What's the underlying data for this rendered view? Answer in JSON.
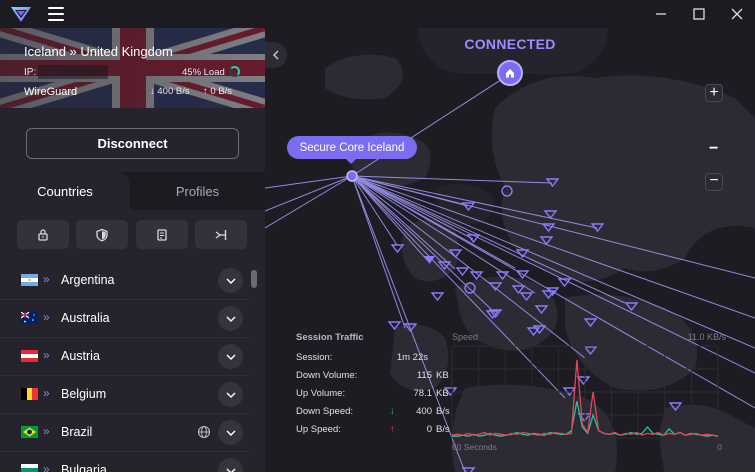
{
  "app": {
    "title": "Proton VPN"
  },
  "connection": {
    "route": "Iceland » United Kingdom",
    "ip_label": "IP:",
    "load": "45% Load",
    "protocol": "WireGuard",
    "down_speed": "400 B/s",
    "up_speed": "0 B/s",
    "disconnect_label": "Disconnect",
    "entry_flag_icon": "iceland-flag",
    "exit_flag_icon": "uk-flag"
  },
  "tabs": [
    {
      "label": "Countries",
      "active": true
    },
    {
      "label": "Profiles",
      "active": false
    }
  ],
  "filters": [
    {
      "icon": "lock-icon",
      "name": "secure-core-filter"
    },
    {
      "icon": "shield-icon",
      "name": "netshield-filter"
    },
    {
      "icon": "p2p-icon",
      "name": "p2p-filter"
    },
    {
      "icon": "tor-icon",
      "name": "tor-filter"
    }
  ],
  "countries": [
    {
      "name": "Argentina",
      "flag": "argentina",
      "globe": false
    },
    {
      "name": "Australia",
      "flag": "australia",
      "globe": false
    },
    {
      "name": "Austria",
      "flag": "austria",
      "globe": false
    },
    {
      "name": "Belgium",
      "flag": "belgium",
      "globe": false
    },
    {
      "name": "Brazil",
      "flag": "brazil",
      "globe": true
    },
    {
      "name": "Bulgaria",
      "flag": "bulgaria",
      "globe": false
    }
  ],
  "map": {
    "status": "CONNECTED",
    "secure_core_label": "Secure Core Iceland",
    "zoom_in": "+",
    "zoom_mid": "−",
    "zoom_out": "−"
  },
  "traffic": {
    "title": "Session Traffic",
    "rows": [
      {
        "label": "Session:",
        "value": "1m 22s",
        "unit": ""
      },
      {
        "label": "Down Volume:",
        "value": "115",
        "unit": "KB"
      },
      {
        "label": "Up Volume:",
        "value": "78.1",
        "unit": "KB"
      },
      {
        "label": "Down Speed:",
        "value": "400",
        "unit": "B/s",
        "arrow": "↓"
      },
      {
        "label": "Up Speed:",
        "value": "0",
        "unit": "B/s",
        "arrow": "↑"
      }
    ]
  },
  "speed_graph": {
    "label": "Speed",
    "max_label": "11.0 KB/s",
    "left_label": "60 Seconds",
    "right_label": "0",
    "colors": {
      "down": "#1fc69b",
      "up": "#e0475b"
    },
    "down_values": [
      0.02,
      0.02,
      0.03,
      0.02,
      0.04,
      0.02,
      0.03,
      0.05,
      0.03,
      0.02,
      0.03,
      0.04,
      0.06,
      0.04,
      0.03,
      0.05,
      0.04,
      0.03,
      0.06,
      0.05,
      0.04,
      0.04,
      0.08,
      0.4,
      0.12,
      0.05,
      0.25,
      0.08,
      0.05,
      0.04,
      0.05,
      0.03,
      0.04,
      0.06,
      0.04,
      0.05,
      0.12,
      0.05,
      0.04,
      0.03,
      0.1,
      0.04,
      0.06,
      0.03,
      0.05,
      0.04,
      0.03,
      0.02,
      0.03,
      0.02
    ],
    "up_values": [
      0.03,
      0.04,
      0.03,
      0.05,
      0.03,
      0.04,
      0.06,
      0.03,
      0.05,
      0.04,
      0.03,
      0.05,
      0.04,
      0.06,
      0.05,
      0.04,
      0.03,
      0.05,
      0.04,
      0.06,
      0.05,
      0.04,
      0.05,
      0.85,
      0.15,
      0.06,
      0.5,
      0.08,
      0.05,
      0.04,
      0.06,
      0.03,
      0.05,
      0.04,
      0.06,
      0.03,
      0.05,
      0.04,
      0.06,
      0.03,
      0.05,
      0.04,
      0.06,
      0.03,
      0.04,
      0.05,
      0.03,
      0.04,
      0.03,
      0.02
    ]
  },
  "colors": {
    "accent": "#7c6cf0",
    "accent_light": "#9c8cff",
    "panel": "#25242c",
    "map_bg": "#1d1c22"
  }
}
